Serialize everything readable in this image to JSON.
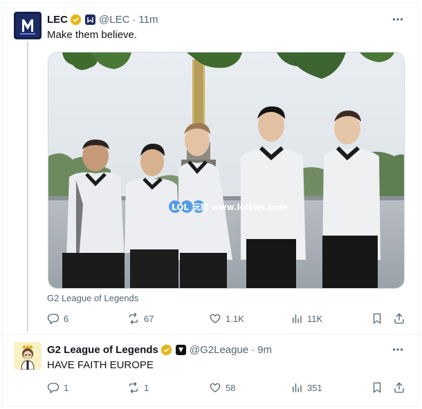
{
  "tweets": [
    {
      "author_name": "LEC",
      "handle": "@LEC",
      "separator": "·",
      "time": "11m",
      "text": "Make them believe.",
      "media_caption": "G2 League of Legends",
      "watermark": "LOL 玩家 www.lolbbs.com",
      "replies": "6",
      "reposts": "67",
      "likes": "1.1K",
      "views": "11K"
    },
    {
      "author_name": "G2 League of Legends",
      "handle": "@G2League",
      "separator": "·",
      "time": "9m",
      "text": "HAVE FAITH EUROPE",
      "replies": "1",
      "reposts": "1",
      "likes": "58",
      "views": "351"
    }
  ],
  "icons": {
    "verified": "verified-badge-icon",
    "more": "more-dots-icon",
    "reply": "reply-icon",
    "repost": "repost-icon",
    "like": "heart-icon",
    "views": "views-chart-icon",
    "bookmark": "bookmark-icon",
    "share": "share-icon"
  },
  "colors": {
    "verified_gold": "#e2b719",
    "secondary_text": "#536471",
    "primary_text": "#0f1419",
    "lec_avatar_bg": "#14204a"
  }
}
